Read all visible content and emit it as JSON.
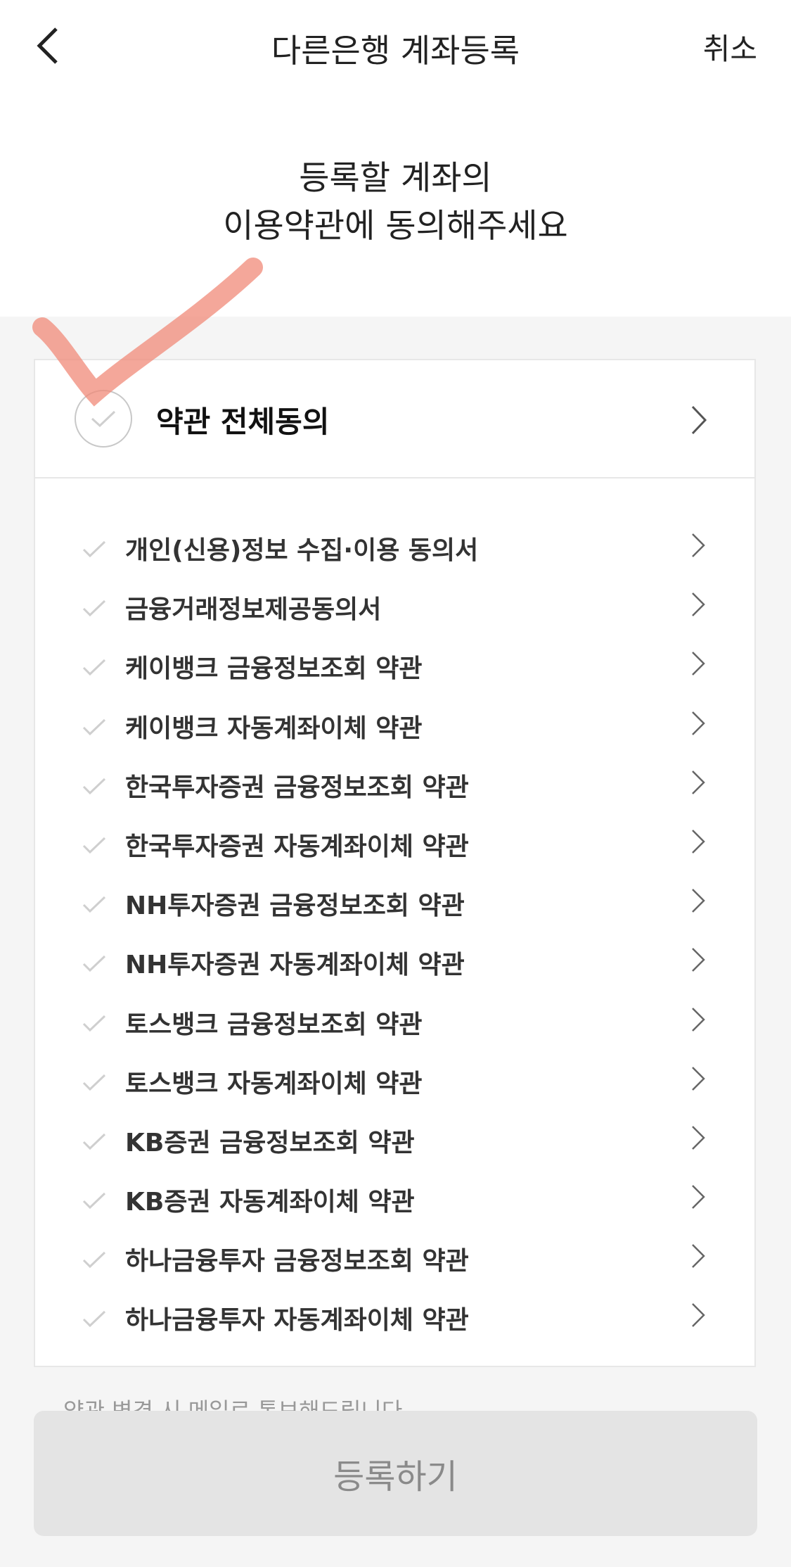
{
  "header": {
    "title": "다른은행 계좌등록",
    "cancel_label": "취소"
  },
  "subtitle": {
    "line1": "등록할 계좌의",
    "line2": "이용약관에 동의해주세요"
  },
  "agree_all": {
    "label": "약관 전체동의"
  },
  "terms": [
    {
      "label": "개인(신용)정보 수집·이용 동의서"
    },
    {
      "label": "금융거래정보제공동의서"
    },
    {
      "label": "케이뱅크 금융정보조회 약관"
    },
    {
      "label": "케이뱅크 자동계좌이체 약관"
    },
    {
      "label": "한국투자증권 금융정보조회 약관"
    },
    {
      "label": "한국투자증권 자동계좌이체 약관"
    },
    {
      "label": "NH투자증권 금융정보조회 약관"
    },
    {
      "label": "NH투자증권 자동계좌이체 약관"
    },
    {
      "label": "토스뱅크 금융정보조회 약관"
    },
    {
      "label": "토스뱅크 자동계좌이체 약관"
    },
    {
      "label": "KB증권 금융정보조회 약관"
    },
    {
      "label": "KB증권 자동계좌이체 약관"
    },
    {
      "label": "하나금융투자 금융정보조회 약관"
    },
    {
      "label": "하나금융투자 자동계좌이체 약관"
    }
  ],
  "notice": "약관 변경 시 메일로 통보해드립니다",
  "register_label": "등록하기",
  "colors": {
    "swoosh": "#f08a78",
    "disabled_button_bg": "#e4e4e4",
    "disabled_button_text": "#8a8a8a"
  }
}
